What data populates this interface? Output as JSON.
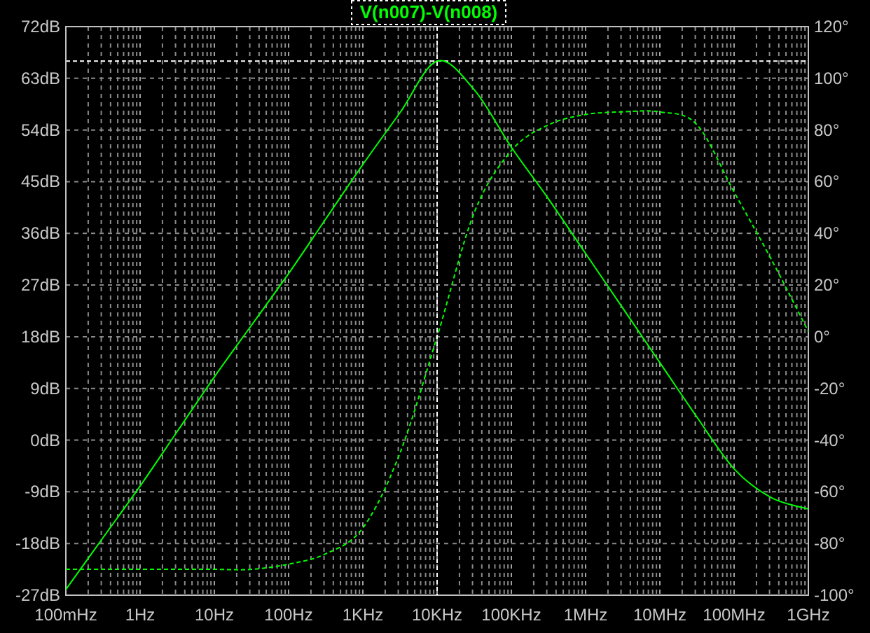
{
  "chart_data": {
    "type": "line",
    "title": "V(n007)-V(n008)",
    "categories": [
      "100mHz",
      null,
      "1Hz",
      null,
      "10Hz",
      null,
      "100Hz",
      null,
      "1KHz",
      null,
      "10KHz",
      null,
      "100KHz",
      null,
      "1MHz",
      null,
      "10MHz",
      null,
      "100MHz",
      null,
      "1GHz"
    ],
    "ylim": [
      -27,
      72
    ],
    "yticks": [
      {
        "value": 72,
        "label": "72dB"
      },
      {
        "value": 63,
        "label": "63dB"
      },
      {
        "value": 54,
        "label": "54dB"
      },
      {
        "value": 45,
        "label": "45dB"
      },
      {
        "value": 36,
        "label": "36dB"
      },
      {
        "value": 27,
        "label": "27dB"
      },
      {
        "value": 18,
        "label": "18dB"
      },
      {
        "value": 9,
        "label": "9dB"
      },
      {
        "value": 0,
        "label": "0dB"
      },
      {
        "value": -9,
        "label": "-9dB"
      },
      {
        "value": -18,
        "label": "-18dB"
      },
      {
        "value": -27,
        "label": "-27dB"
      }
    ],
    "y2lim": [
      -100,
      120
    ],
    "y2ticks": [
      {
        "value": 120,
        "label": "120°"
      },
      {
        "value": 100,
        "label": "100°"
      },
      {
        "value": 80,
        "label": "80°"
      },
      {
        "value": 60,
        "label": "60°"
      },
      {
        "value": 40,
        "label": "40°"
      },
      {
        "value": 20,
        "label": "20°"
      },
      {
        "value": 0,
        "label": "0°"
      },
      {
        "value": -20,
        "label": "-20°"
      },
      {
        "value": -40,
        "label": "-40°"
      },
      {
        "value": -60,
        "label": "-60°"
      },
      {
        "value": -80,
        "label": "-80°"
      },
      {
        "value": -100,
        "label": "-100°"
      }
    ],
    "series": [
      {
        "color": "#00ff00",
        "line_style": "solid",
        "values": [
          -26,
          -17,
          -8,
          1.5,
          11,
          20,
          29,
          38.5,
          48,
          57,
          66,
          61,
          51,
          42,
          32.5,
          23,
          13.5,
          4,
          -5,
          -10,
          -12
        ]
      },
      {
        "color": "#00ff00",
        "axis": "y2",
        "line_style": "dashed",
        "values": [
          -90,
          -90,
          -90,
          -90,
          -90,
          -90,
          -88,
          -84,
          -74,
          -45,
          0,
          48,
          72,
          82,
          86,
          87,
          87,
          82,
          56,
          30,
          2
        ]
      }
    ],
    "ref_lines": [
      {
        "axis": "y",
        "value": 66
      }
    ],
    "grid": true
  }
}
